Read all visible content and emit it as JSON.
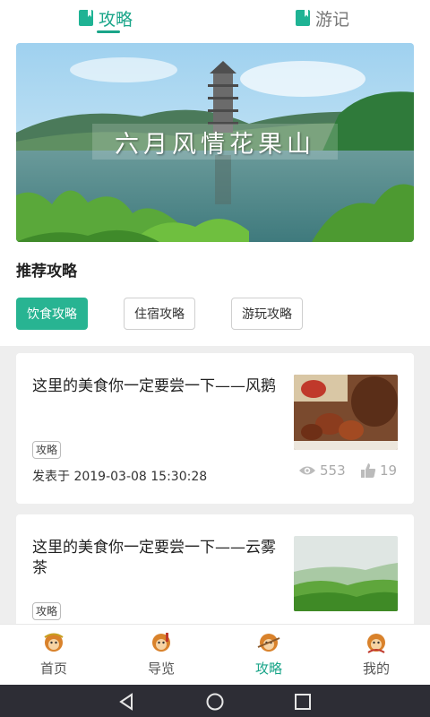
{
  "top_tabs": [
    {
      "label": "攻略",
      "active": true
    },
    {
      "label": "游记",
      "active": false
    }
  ],
  "banner": {
    "caption": "六月风情花果山"
  },
  "recommend": {
    "title": "推荐攻略",
    "filters": [
      {
        "label": "饮食攻略",
        "active": true
      },
      {
        "label": "住宿攻略",
        "active": false
      },
      {
        "label": "游玩攻略",
        "active": false
      }
    ]
  },
  "articles": [
    {
      "title": "这里的美食你一定要尝一下——风鹅",
      "tag": "攻略",
      "date": "发表于 2019-03-08 15:30:28",
      "views": "553",
      "likes": "19"
    },
    {
      "title": "这里的美食你一定要尝一下——云雾茶",
      "tag": "攻略"
    }
  ],
  "bottom_nav": [
    {
      "label": "首页",
      "active": false
    },
    {
      "label": "导览",
      "active": false
    },
    {
      "label": "攻略",
      "active": true
    },
    {
      "label": "我的",
      "active": false
    }
  ],
  "colors": {
    "accent": "#1aa589",
    "filter_active": "#28b492",
    "system_bar": "#2d2d35"
  },
  "icons": [
    "book-icon",
    "eye-icon",
    "thumbs-up-icon",
    "monkey-king-icon",
    "back-icon",
    "home-icon",
    "recents-icon"
  ]
}
